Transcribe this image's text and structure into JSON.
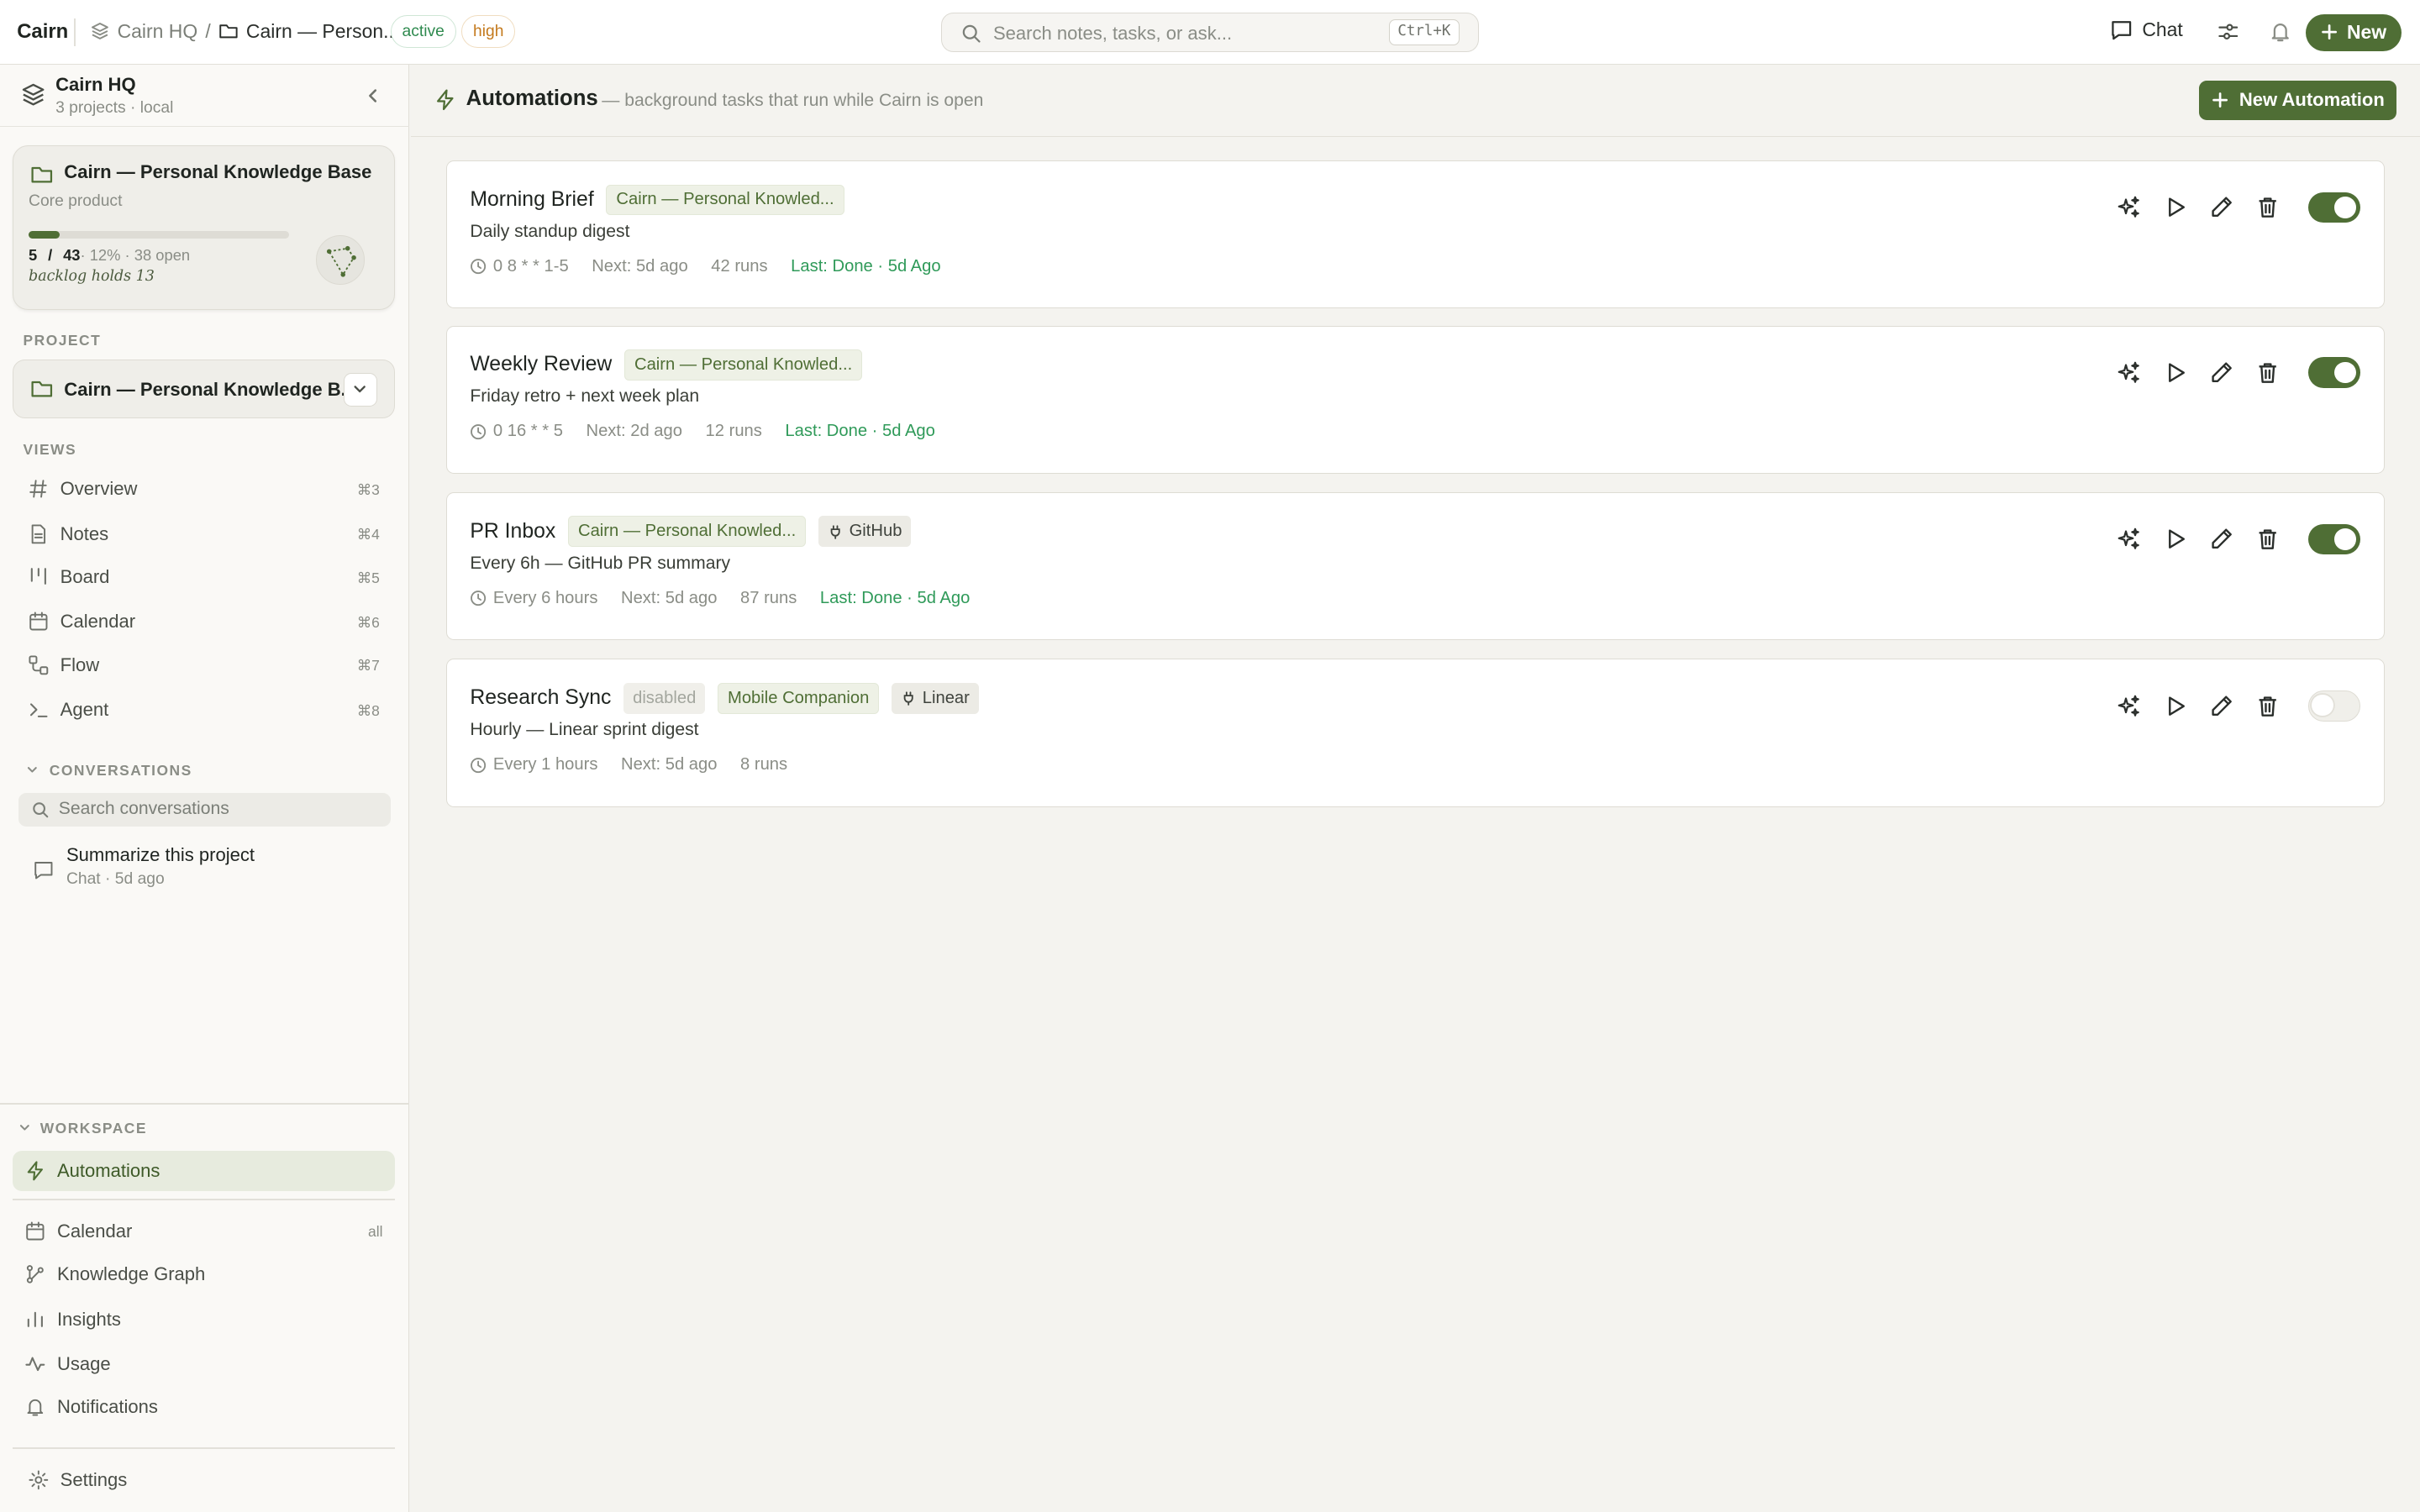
{
  "topbar": {
    "brand": "Cairn",
    "crumbs": [
      "Cairn HQ",
      "/",
      "Cairn — Person..."
    ],
    "status_active": "active",
    "status_priority": "high",
    "search_placeholder": "Search notes, tasks, or ask...",
    "search_shortcut": "Ctrl+K",
    "chat_label": "Chat",
    "new_label": "New",
    "accent_color": "#4f6e35"
  },
  "sidebar": {
    "workspace": {
      "name": "Cairn HQ",
      "sub": "3 projects · local"
    },
    "project_card": {
      "title": "Cairn — Personal Knowledge Base",
      "subtitle": "Core product",
      "done": "5",
      "sep": "/",
      "total": "43",
      "extra": " · 12% · 38 open",
      "progress_fraction": 0.12,
      "note": "backlog holds 13"
    },
    "project_section": "PROJECT",
    "project_select": "Cairn — Personal Knowledge B...",
    "views_section": "VIEWS",
    "views": [
      {
        "label": "Overview",
        "shortcut": "⌘3",
        "icon": "hash-icon"
      },
      {
        "label": "Notes",
        "shortcut": "⌘4",
        "icon": "file-icon"
      },
      {
        "label": "Board",
        "shortcut": "⌘5",
        "icon": "board-icon"
      },
      {
        "label": "Calendar",
        "shortcut": "⌘6",
        "icon": "calendar-icon"
      },
      {
        "label": "Flow",
        "shortcut": "⌘7",
        "icon": "flow-icon"
      },
      {
        "label": "Agent",
        "shortcut": "⌘8",
        "icon": "terminal-icon"
      }
    ],
    "conversations_section": "CONVERSATIONS",
    "conversation_search": "Search conversations",
    "conversation": {
      "title": "Summarize this project",
      "meta": "Chat · 5d ago"
    },
    "workspace_section": "WORKSPACE",
    "workspace_items": [
      {
        "label": "Automations",
        "badge": ""
      },
      {
        "label": "Calendar",
        "badge": "all"
      },
      {
        "label": "Knowledge Graph",
        "badge": ""
      },
      {
        "label": "Insights",
        "badge": ""
      },
      {
        "label": "Usage",
        "badge": ""
      },
      {
        "label": "Notifications",
        "badge": ""
      }
    ],
    "settings": "Settings"
  },
  "main": {
    "title": "Automations",
    "subtitle": "— background tasks that run while Cairn is open",
    "new_button": "New Automation",
    "automations": [
      {
        "name": "Morning Brief",
        "project": "Cairn — Personal Knowled...",
        "description": "Daily standup digest",
        "schedule": "0 8 * * 1-5",
        "next": "Next: 5d ago",
        "runs": "42 runs",
        "last": "Last: Done · 5d Ago",
        "enabled": true
      },
      {
        "name": "Weekly Review",
        "project": "Cairn — Personal Knowled...",
        "description": "Friday retro + next week plan",
        "schedule": "0 16 * * 5",
        "next": "Next: 2d ago",
        "runs": "12 runs",
        "last": "Last: Done · 5d Ago",
        "enabled": true
      },
      {
        "name": "PR Inbox",
        "project": "Cairn — Personal Knowled...",
        "integration": "GitHub",
        "description": "Every 6h — GitHub PR summary",
        "schedule": "Every 6 hours",
        "next": "Next: 5d ago",
        "runs": "87 runs",
        "last": "Last: Done · 5d Ago",
        "enabled": true
      },
      {
        "name": "Research Sync",
        "status": "disabled",
        "project": "Mobile Companion",
        "integration": "Linear",
        "description": "Hourly — Linear sprint digest",
        "schedule": "Every 1 hours",
        "next": "Next: 5d ago",
        "runs": "8 runs",
        "enabled": false
      }
    ]
  }
}
